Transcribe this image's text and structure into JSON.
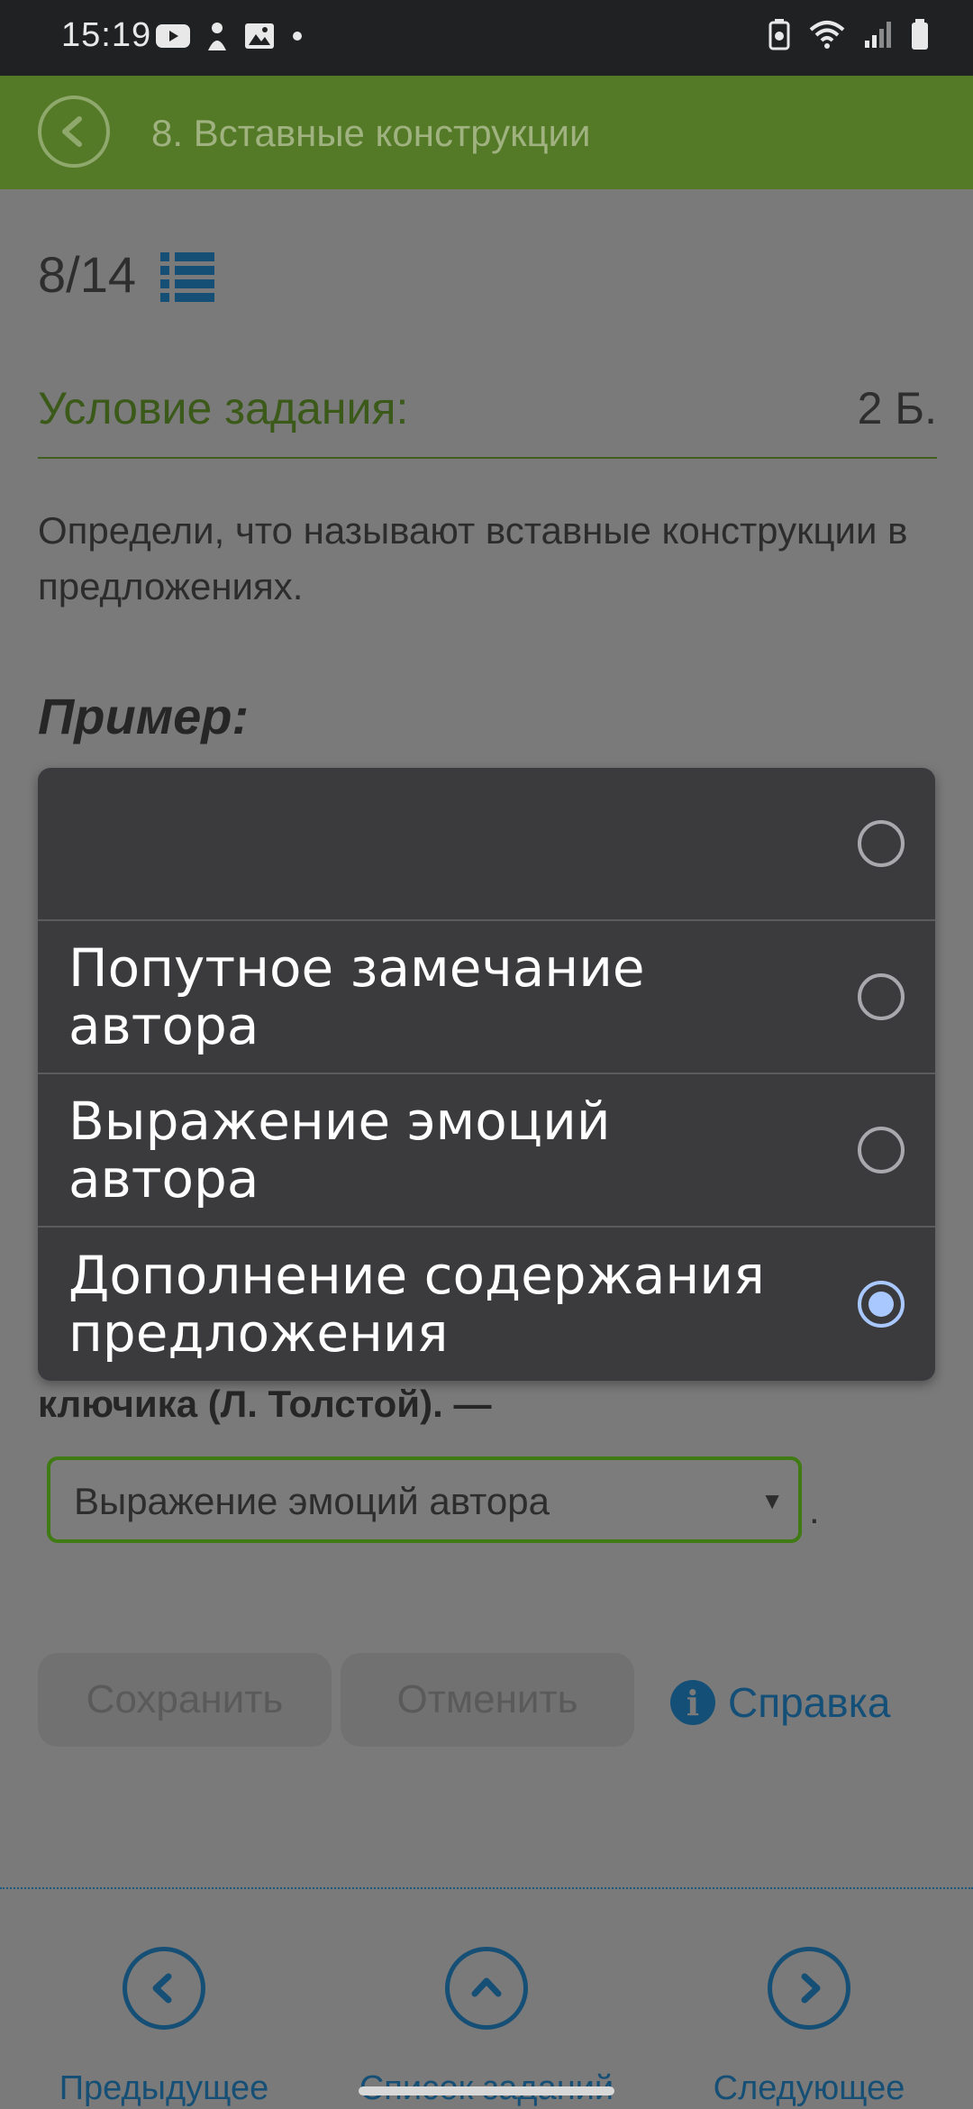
{
  "status_bar": {
    "time": "15:19"
  },
  "header": {
    "title": "8. Вставные конструкции"
  },
  "progress": {
    "counter": "8/14"
  },
  "task": {
    "condition_title": "Условие задания:",
    "points": "2 Б.",
    "question": "Определи, что называют вставные конструкции в предложениях.",
    "example_title": "Пример:",
    "sentence_tail": "ключика (Л. Толстой). —",
    "select_value": "Выражение эмоций автора",
    "after_select": "."
  },
  "dropdown": {
    "options": [
      {
        "label": "",
        "selected": false
      },
      {
        "label": "Попутное замечание автора",
        "selected": false
      },
      {
        "label": "Выражение эмоций автора",
        "selected": false
      },
      {
        "label": "Дополнение содержания предложения",
        "selected": true
      }
    ]
  },
  "actions": {
    "save": "Сохранить",
    "cancel": "Отменить",
    "help": "Справка"
  },
  "bottom_nav": {
    "prev": "Предыдущее",
    "list": "Список заданий",
    "next": "Следующее"
  },
  "colors": {
    "header_bg": "#547a28",
    "accent_blue": "#164f75",
    "dropdown_bg": "#3b3b3e",
    "radio_selected": "#a8c8ff"
  }
}
